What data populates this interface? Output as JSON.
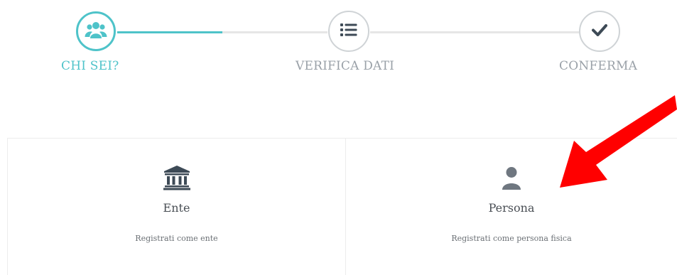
{
  "stepper": {
    "steps": [
      {
        "label": "CHI SEI?",
        "icon": "users-icon",
        "state": "active"
      },
      {
        "label": "VERIFICA DATI",
        "icon": "list-icon",
        "state": "pending"
      },
      {
        "label": "CONFERMA",
        "icon": "check-icon",
        "state": "pending"
      }
    ],
    "progress": 0.5
  },
  "options": [
    {
      "title": "Ente",
      "description": "Registrati come ente",
      "icon": "institution-icon"
    },
    {
      "title": "Persona",
      "description": "Registrati come persona fisica",
      "icon": "user-icon"
    }
  ],
  "annotation": {
    "icon": "red-arrow-icon",
    "points_to": "Persona"
  },
  "colors": {
    "accent": "#4ec3c9",
    "inactive_text": "#9aa1a8",
    "icon_dark": "#3d4a56",
    "icon_gray": "#6f7780",
    "arrow": "#ff0000"
  }
}
